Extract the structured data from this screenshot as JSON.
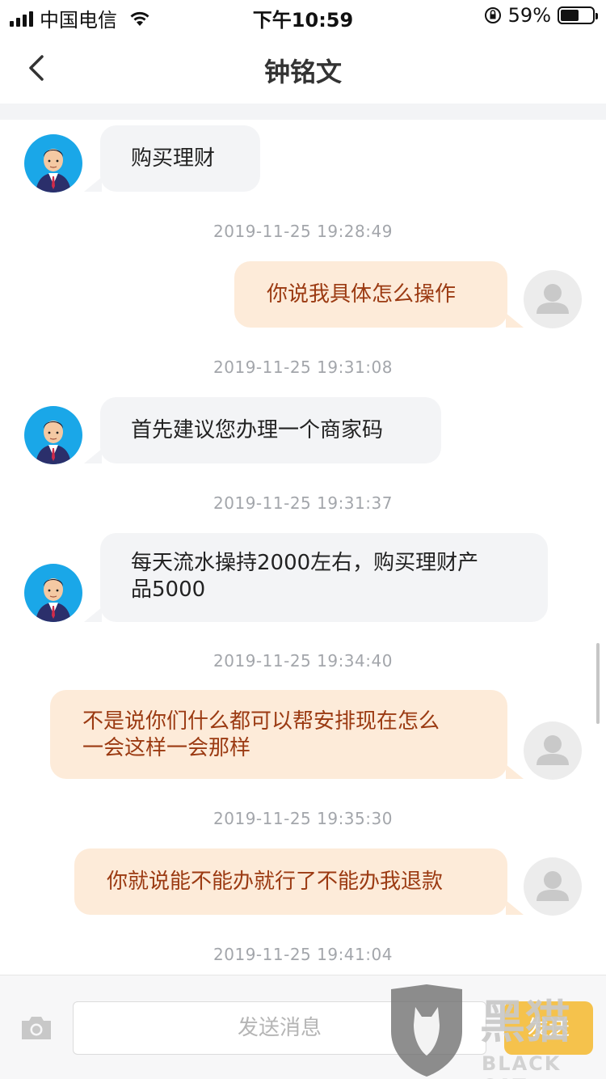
{
  "status_bar": {
    "carrier": "中国电信",
    "time": "下午10:59",
    "battery_percent": "59%",
    "battery_level": 0.59
  },
  "nav": {
    "title": "钟铭文"
  },
  "messages": [
    {
      "side": "in",
      "text": "购买理财"
    },
    {
      "timestamp": "2019-11-25 19:28:49"
    },
    {
      "side": "out",
      "text": "你说我具体怎么操作"
    },
    {
      "timestamp": "2019-11-25 19:31:08"
    },
    {
      "side": "in",
      "text": "首先建议您办理一个商家码"
    },
    {
      "timestamp": "2019-11-25 19:31:37"
    },
    {
      "side": "in",
      "line1": "每天流水操持2000左右，购买理财产",
      "line2": "品5000"
    },
    {
      "timestamp": "2019-11-25 19:34:40"
    },
    {
      "side": "out",
      "line1": "不是说你们什么都可以帮安排现在怎么",
      "line2": "一会这样一会那样"
    },
    {
      "timestamp": "2019-11-25 19:35:30"
    },
    {
      "side": "out",
      "text": "你就说能不能办就行了不能办我退款"
    },
    {
      "timestamp": "2019-11-25 19:41:04"
    }
  ],
  "input_bar": {
    "placeholder": "发送消息",
    "send_label": "发送",
    "camera_icon": "camera-icon"
  },
  "watermark": {
    "cn": "黑猫",
    "en": "BLACK CAT"
  },
  "colors": {
    "incoming_bubble": "#f3f4f6",
    "outgoing_bubble": "#fdebd9",
    "outgoing_text": "#9b3a12",
    "agent_avatar": "#1aa7e8",
    "send_button": "#f5c24c"
  }
}
